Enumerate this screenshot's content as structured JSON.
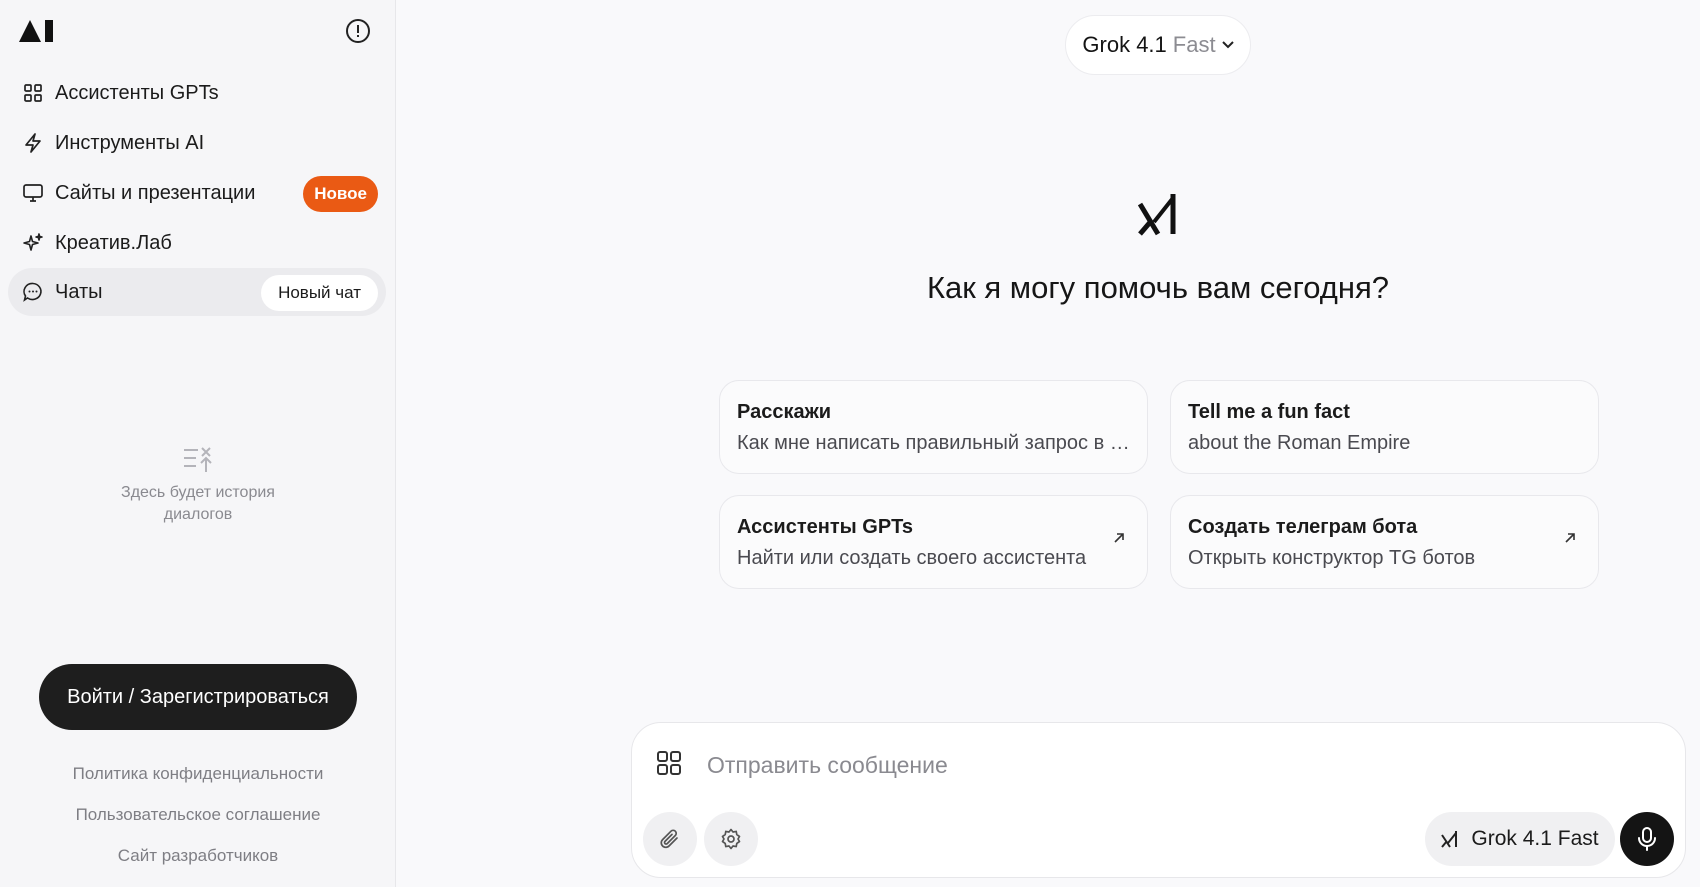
{
  "sidebar": {
    "nav": [
      {
        "label": "Ассистенты GPTs",
        "icon": "grid-icon"
      },
      {
        "label": "Инструменты AI",
        "icon": "lightning-icon"
      },
      {
        "label": "Сайты и презентации",
        "icon": "monitor-icon",
        "badge": "Новое"
      },
      {
        "label": "Креатив.Лаб",
        "icon": "sparkle-icon"
      },
      {
        "label": "Чаты",
        "icon": "chat-bubble-icon",
        "action": "Новый чат"
      }
    ],
    "empty_history": "Здесь будет история диалогов",
    "login_label": "Войти / Зарегистрироваться",
    "footer_links": [
      "Политика конфиденциальности",
      "Пользовательское соглашение",
      "Сайт разработчиков"
    ]
  },
  "header": {
    "model_name": "Grok 4.1",
    "model_variant": "Fast"
  },
  "main": {
    "headline": "Как я могу помочь вам сегодня?",
    "cards": [
      {
        "title": "Расскажи",
        "subtitle": "Как мне написать правильный запрос в чат?"
      },
      {
        "title": "Tell me a fun fact",
        "subtitle": "about the Roman Empire"
      },
      {
        "title": "Ассистенты GPTs",
        "subtitle": "Найти или создать своего ассистента",
        "icon": "arrow-up-right-icon"
      },
      {
        "title": "Создать телеграм бота",
        "subtitle": "Открыть конструктор TG ботов",
        "icon": "arrow-up-right-icon"
      }
    ]
  },
  "composer": {
    "placeholder": "Отправить сообщение",
    "model_chip": "Grok 4.1 Fast"
  },
  "colors": {
    "accent": "#ea5a14",
    "dark": "#1e1e1e"
  }
}
